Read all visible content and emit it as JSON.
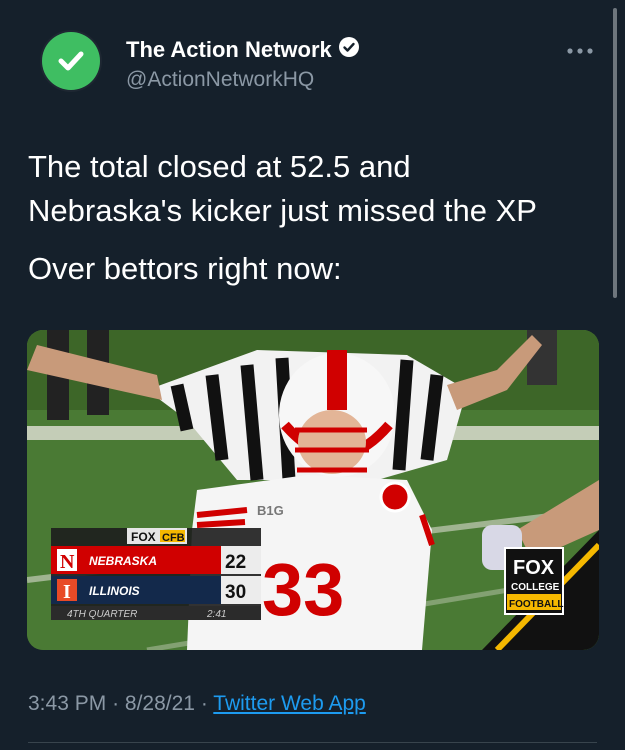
{
  "author": {
    "display_name": "The Action Network",
    "handle": "@ActionNetworkHQ",
    "verified": true
  },
  "tweet": {
    "line1": "The total closed at 52.5 and",
    "line2": "Nebraska's kicker just missed the XP",
    "line3": "Over bettors right now:"
  },
  "meta": {
    "time": "3:43 PM",
    "separator1": "·",
    "date": "8/28/21",
    "separator2": "·",
    "source": "Twitter Web App"
  },
  "scorebug": {
    "network": "FOX",
    "network_sub": "CFB",
    "team1": {
      "letter": "N",
      "name": "NEBRASKA",
      "score": "22"
    },
    "team2": {
      "letter": "I",
      "name": "ILLINOIS",
      "score": "30"
    },
    "period": "4TH QUARTER",
    "clock": "2:41",
    "jersey_number": "33",
    "conference": "B1G",
    "fox_logo": {
      "line1": "FOX",
      "line2": "COLLEGE",
      "line3": "FOOTBALL"
    }
  },
  "colors": {
    "background": "#15202b",
    "accent": "#1d9bf0",
    "secondary_text": "#8b98a5",
    "avatar_green": "#3fbe62",
    "nebraska_red": "#d00000",
    "illinois_orange": "#e84a27"
  },
  "icons": {
    "avatar": "check-logo",
    "verified": "verified-badge-icon",
    "more": "more-options-icon"
  }
}
